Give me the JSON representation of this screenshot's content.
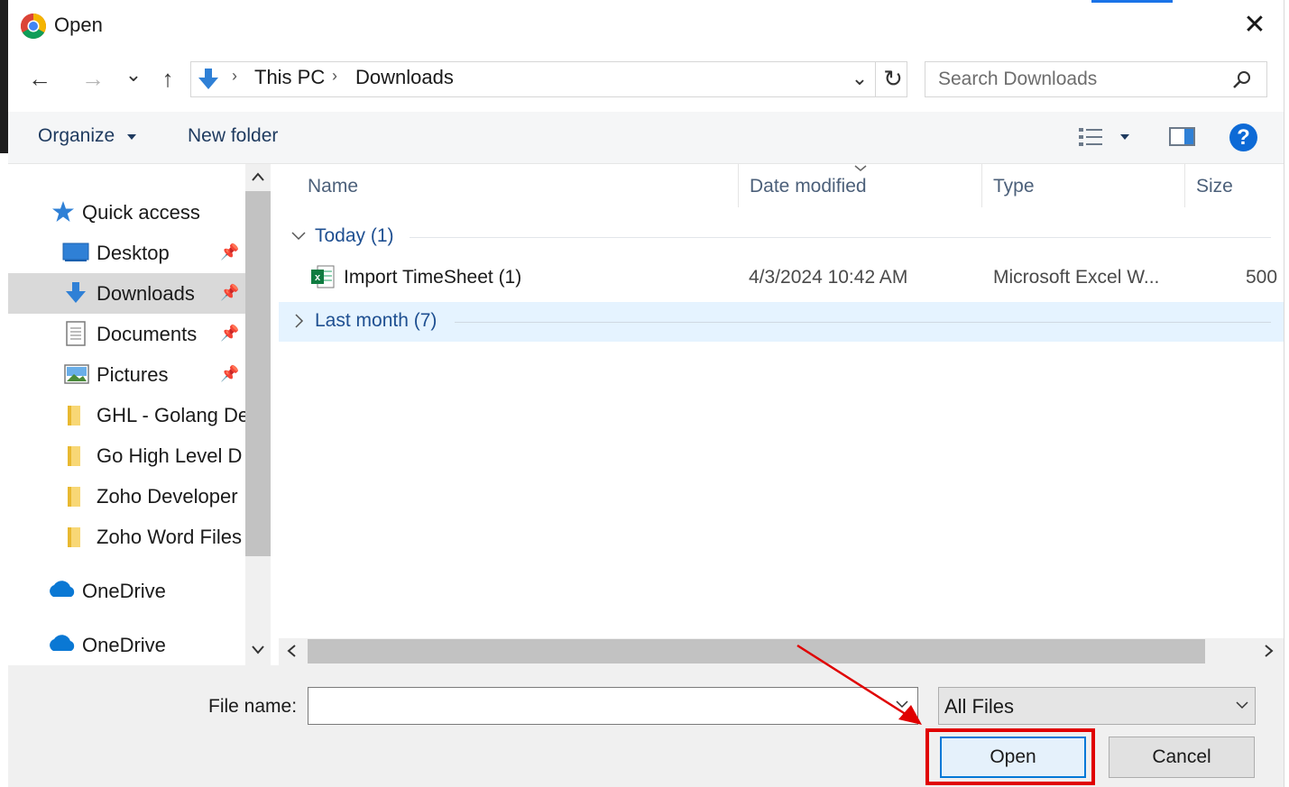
{
  "window": {
    "title": "Open",
    "close_glyph": "✕"
  },
  "nav": {
    "back": "←",
    "forward": "→",
    "recent": "⌄",
    "up": "↑",
    "breadcrumb": [
      "This PC",
      "Downloads"
    ],
    "breadcrumb_sep": "›",
    "dropdown": "⌄",
    "refresh": "↻",
    "search_placeholder": "Search Downloads"
  },
  "toolbar": {
    "organize": "Organize",
    "new_folder": "New folder",
    "help": "?"
  },
  "sidebar": {
    "quick_access": "Quick access",
    "items": [
      {
        "label": "Desktop",
        "icon": "desktop-icon",
        "pinned": true
      },
      {
        "label": "Downloads",
        "icon": "download-arrow-icon",
        "pinned": true,
        "selected": true
      },
      {
        "label": "Documents",
        "icon": "document-icon",
        "pinned": true
      },
      {
        "label": "Pictures",
        "icon": "pictures-icon",
        "pinned": true
      },
      {
        "label": "GHL - Golang De",
        "icon": "folder-icon"
      },
      {
        "label": "Go High Level D",
        "icon": "folder-icon"
      },
      {
        "label": "Zoho Developer",
        "icon": "folder-icon"
      },
      {
        "label": "Zoho Word Files",
        "icon": "folder-icon"
      }
    ],
    "onedrive": [
      "OneDrive",
      "OneDrive"
    ]
  },
  "columns": {
    "name": "Name",
    "date": "Date modified",
    "type": "Type",
    "size": "Size"
  },
  "groups": {
    "today": "Today (1)",
    "last_month": "Last month (7)"
  },
  "files": [
    {
      "name": "Import TimeSheet  (1)",
      "date": "4/3/2024 10:42 AM",
      "type": "Microsoft Excel W...",
      "size": "500"
    }
  ],
  "bottom": {
    "file_name_label": "File name:",
    "file_name_value": "",
    "filter": "All Files",
    "open": "Open",
    "cancel": "Cancel"
  },
  "colors": {
    "accent": "#0078d7",
    "annotation": "#e00000",
    "selection": "#e5f3ff"
  }
}
